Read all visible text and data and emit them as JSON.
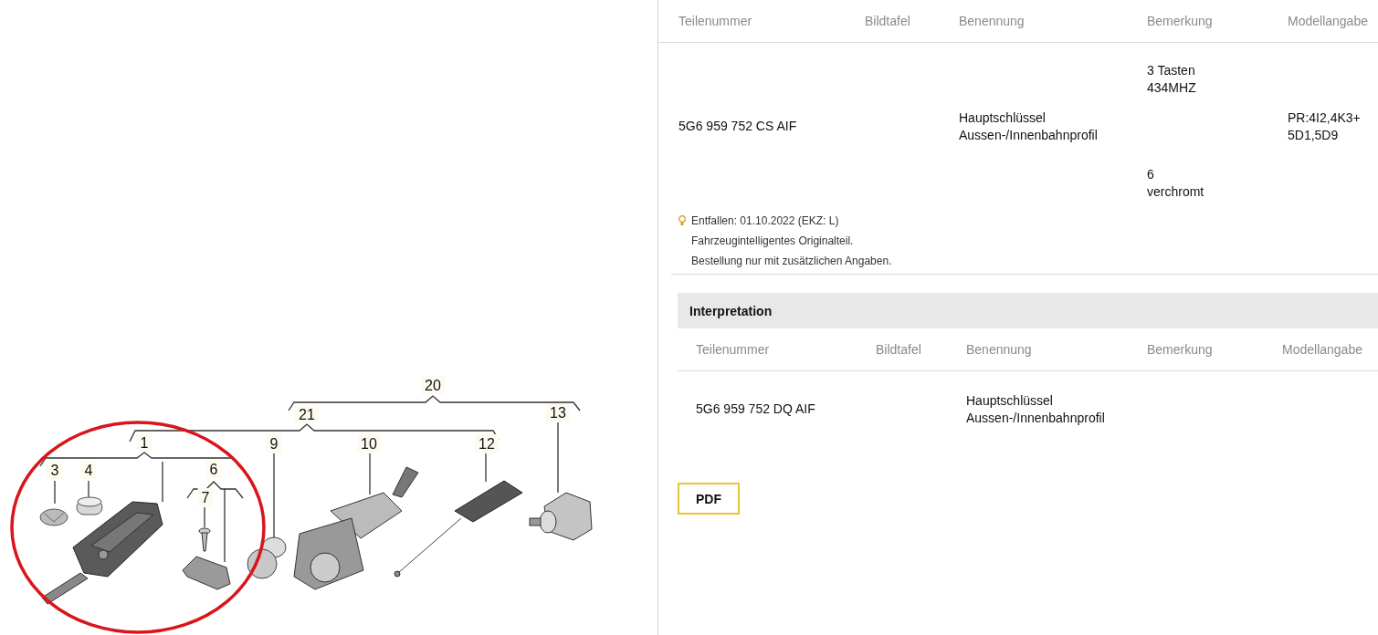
{
  "diagram": {
    "callouts": [
      {
        "label": "20"
      },
      {
        "label": "21"
      },
      {
        "label": "1"
      },
      {
        "label": "3"
      },
      {
        "label": "4"
      },
      {
        "label": "6"
      },
      {
        "label": "7"
      },
      {
        "label": "9"
      },
      {
        "label": "10"
      },
      {
        "label": "12"
      },
      {
        "label": "13"
      }
    ]
  },
  "parts_table": {
    "columns": [
      "Teilenummer",
      "Bildtafel",
      "Benennung",
      "Bemerkung",
      "Modellangabe"
    ],
    "rows": [
      {
        "teilenummer": "5G6 959 752 CS AIF",
        "benennung": "Hauptschlüssel\nAussen-/Innenbahnprofil",
        "bemerkung": [
          "3 Tasten\n434MHZ",
          "6\nverchromt"
        ],
        "modellangabe": "PR:4I2,4K3+\n5D1,5D9"
      }
    ],
    "notes": [
      "Entfallen: 01.10.2022 (EKZ: L)",
      "Fahrzeugintelligentes Originalteil.",
      "Bestellung nur mit zusätzlichen Angaben."
    ]
  },
  "interpretation": {
    "title": "Interpretation",
    "columns": [
      "Teilenummer",
      "Bildtafel",
      "Benennung",
      "Bemerkung",
      "Modellangabe"
    ],
    "rows": [
      {
        "teilenummer": "5G6 959 752 DQ AIF",
        "benennung": "Hauptschlüssel\nAussen-/Innenbahnprofil"
      }
    ]
  },
  "pdf_button": "PDF"
}
